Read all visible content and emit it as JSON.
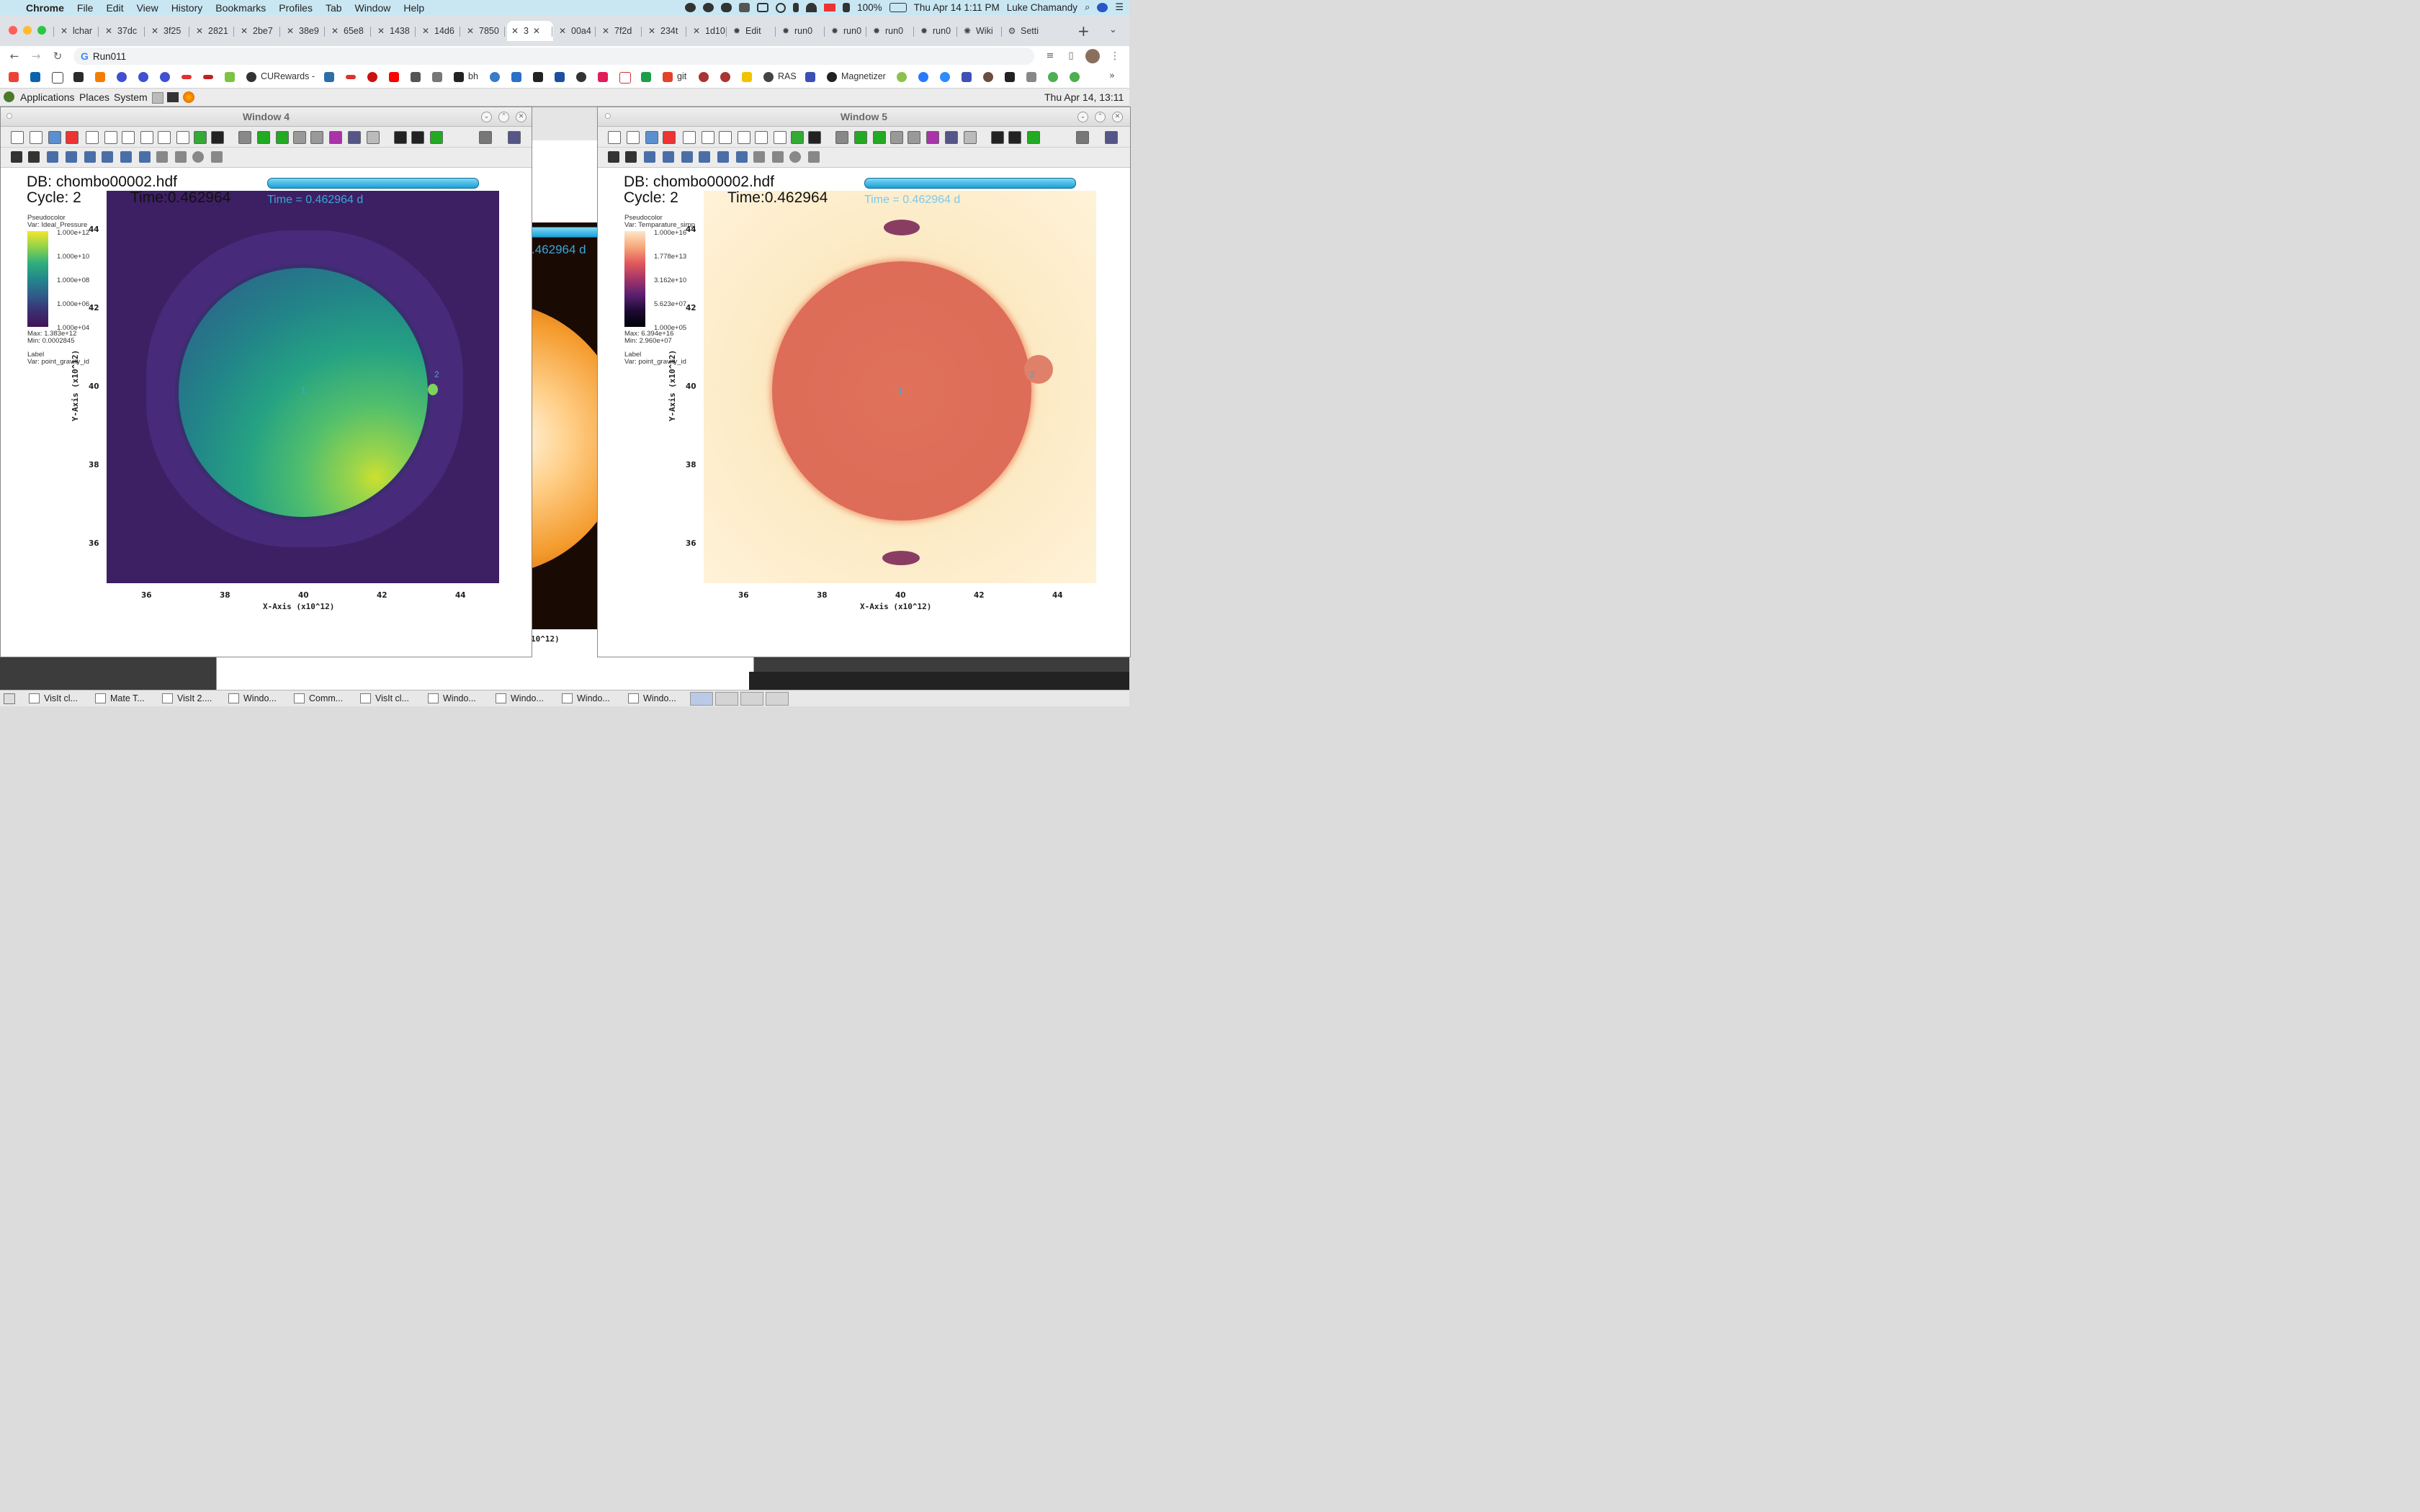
{
  "menubar": {
    "apple": "",
    "app": "Chrome",
    "items": [
      "File",
      "Edit",
      "View",
      "History",
      "Bookmarks",
      "Profiles",
      "Tab",
      "Window",
      "Help"
    ],
    "battery": "100%",
    "datetime": "Thu Apr 14  1:11 PM",
    "user": "Luke Chamandy"
  },
  "tabs": [
    "lchar",
    "37dc",
    "3f25",
    "2821",
    "2be7",
    "38e9",
    "65e8",
    "1438",
    "14d6",
    "7850",
    "3",
    "00a4",
    "7f2d",
    "234t",
    "1d10",
    "Edit",
    "run0",
    "run0",
    "run0",
    "run0",
    "Wiki",
    "Setti"
  ],
  "active_tab_index": 10,
  "address": {
    "value": "Run011"
  },
  "bookmarks": {
    "cu": "CURewards -",
    "bh": "bh",
    "git": "git",
    "ras": "RAS",
    "magnetizer": "Magnetizer"
  },
  "gnome": {
    "applications": "Applications",
    "places": "Places",
    "system": "System",
    "clock": "Thu Apr 14, 13:11"
  },
  "window4": {
    "title": "Window 4",
    "db": "DB: chombo00002.hdf",
    "cycle": "Cycle: 2",
    "time_big": "Time:0.462964",
    "time_blue": "Time = 0.462964 d",
    "legend_title": "Pseudocolor",
    "legend_var": "Var: Ideal_Pressure",
    "legend_ticks": [
      "1.000e+12",
      "1.000e+10",
      "1.000e+08",
      "1.000e+06",
      "1.000e+04"
    ],
    "max": "Max:  1.383e+12",
    "min": "Min:  0.0002845",
    "label_title": "Label",
    "label_var": "Var: point_gravity_id",
    "y_ticks": [
      "44",
      "42",
      "40",
      "38",
      "36"
    ],
    "x_ticks": [
      "36",
      "38",
      "40",
      "42",
      "44"
    ],
    "xlabel": "X-Axis (x10^12)",
    "ylabel": "Y-Axis (x10^12)",
    "point1": "1",
    "point2": "2"
  },
  "window5": {
    "title": "Window 5",
    "db": "DB: chombo00002.hdf",
    "cycle": "Cycle: 2",
    "time_big": "Time:0.462964",
    "time_blue": "Time = 0.462964 d",
    "legend_title": "Pseudocolor",
    "legend_var": "Var: Temparature_simp",
    "legend_ticks": [
      "1.000e+16",
      "1.778e+13",
      "3.162e+10",
      "5.623e+07",
      "1.000e+05"
    ],
    "max": "Max:  6.394e+16",
    "min": "Min:  2.960e+07",
    "label_title": "Label",
    "label_var": "Var: point_gravity_id",
    "y_ticks": [
      "44",
      "42",
      "40",
      "38",
      "36"
    ],
    "x_ticks": [
      "36",
      "38",
      "40",
      "42",
      "44"
    ],
    "xlabel": "X-Axis (x10^12)",
    "ylabel": "Y-Axis (x10^12)",
    "point1": "1",
    "point2": "2"
  },
  "background_window": {
    "time_fragment": ".462964 d",
    "axis_fragment": "10^12)"
  },
  "taskbar": [
    "VisIt cl...",
    "Mate T...",
    "VisIt 2....",
    "Windo...",
    "Comm...",
    "VisIt cl...",
    "Windo...",
    "Windo...",
    "Windo...",
    "Windo..."
  ]
}
